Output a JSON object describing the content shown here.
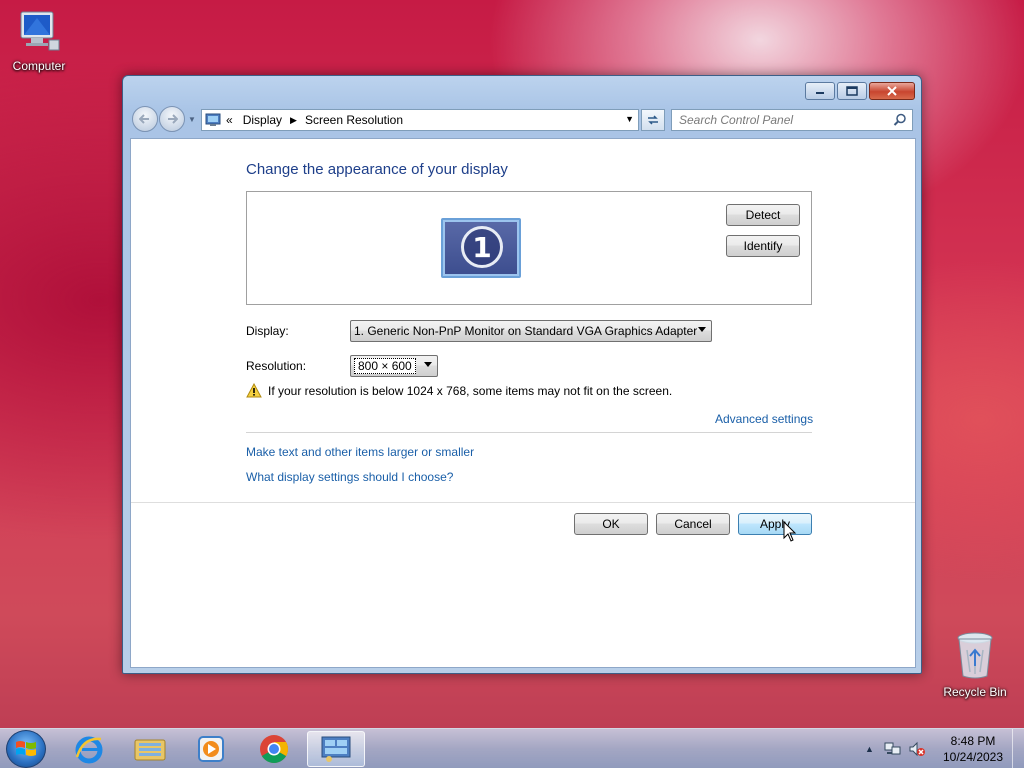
{
  "desktop": {
    "computer_label": "Computer",
    "recycle_label": "Recycle Bin"
  },
  "window": {
    "breadcrumb": {
      "overflow": "«",
      "items": [
        "Display",
        "Screen Resolution"
      ]
    },
    "search_placeholder": "Search Control Panel",
    "title": "Change the appearance of your display",
    "monitor_number": "1",
    "detect_label": "Detect",
    "identify_label": "Identify",
    "display_label": "Display:",
    "display_value": "1. Generic Non-PnP Monitor on Standard VGA Graphics Adapter",
    "resolution_label": "Resolution:",
    "resolution_value": "800 × 600",
    "warning_text": "If your resolution is below 1024 x 768, some items may not fit on the screen.",
    "advanced_link": "Advanced settings",
    "text_size_link": "Make text and other items larger or smaller",
    "help_link": "What display settings should I choose?",
    "ok_label": "OK",
    "cancel_label": "Cancel",
    "apply_label": "Apply"
  },
  "taskbar": {
    "time": "8:48 PM",
    "date": "10/24/2023",
    "pinned": [
      "internet-explorer",
      "windows-explorer",
      "media-player",
      "chrome",
      "control-panel"
    ]
  },
  "colors": {
    "link": "#1a5fa8",
    "title": "#1e3f8a"
  }
}
